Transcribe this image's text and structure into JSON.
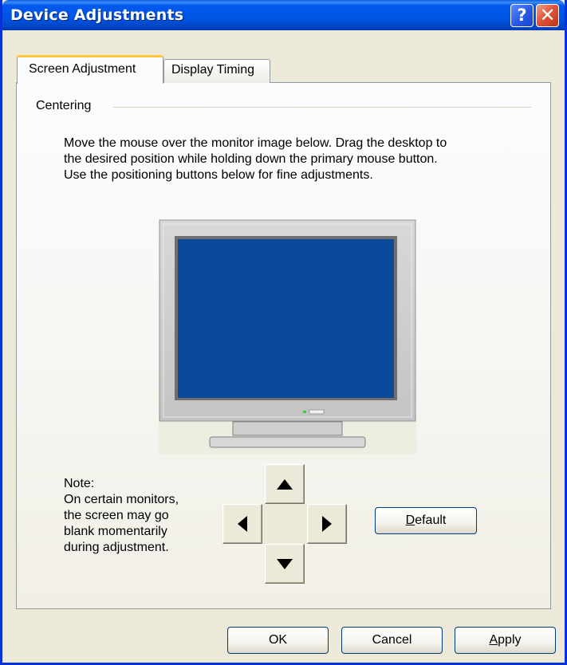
{
  "window": {
    "title": "Device Adjustments",
    "help_glyph": "?",
    "close_glyph": "✕"
  },
  "tabs": [
    {
      "label": "Screen Adjustment",
      "selected": true
    },
    {
      "label": "Display Timing",
      "selected": false
    }
  ],
  "centering": {
    "group_label": "Centering",
    "description": [
      "Move the mouse over the monitor image below. Drag the desktop to",
      "the desired position while holding down the primary mouse button.",
      "Use the positioning buttons below for fine adjustments."
    ]
  },
  "note": [
    "Note:",
    "On certain monitors,",
    "the screen may go",
    "blank momentarily",
    "during adjustment."
  ],
  "arrows": {
    "up": "arrow-up-icon",
    "down": "arrow-down-icon",
    "left": "arrow-left-icon",
    "right": "arrow-right-icon"
  },
  "buttons": {
    "default": {
      "mnemonic": "D",
      "rest": "efault"
    },
    "ok": "OK",
    "cancel": "Cancel",
    "apply": {
      "mnemonic": "A",
      "rest": "pply"
    }
  },
  "colors": {
    "title_bar": "#0054e3",
    "monitor_screen": "#0a4a9a",
    "tab_highlight": "#ffc83c"
  }
}
